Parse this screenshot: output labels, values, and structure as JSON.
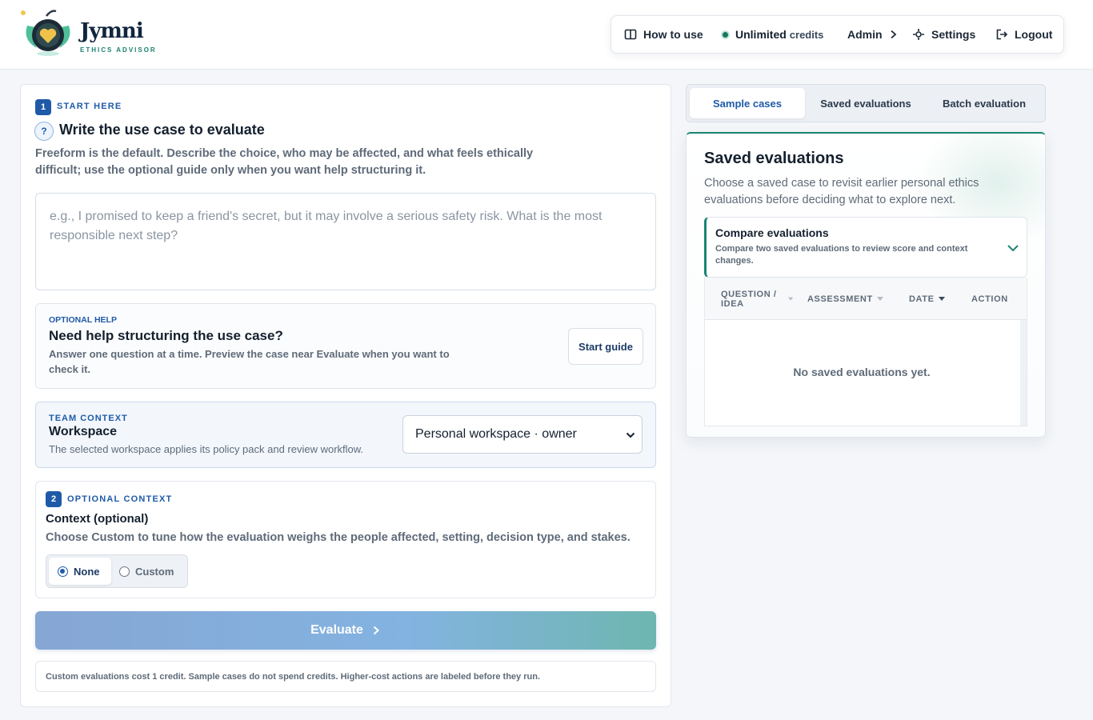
{
  "brand": {
    "name": "Jymni",
    "tagline": "ETHICS ADVISOR"
  },
  "topnav": {
    "how_to_use": "How to use",
    "credits_value": "Unlimited",
    "credits_suffix": "credits",
    "admin": "Admin",
    "settings": "Settings",
    "logout": "Logout"
  },
  "step1": {
    "number": "1",
    "eyebrow": "START HERE",
    "help_glyph": "?",
    "title": "Write the use case to evaluate",
    "intro": "Freeform is the default. Describe the choice, who may be affected, and what feels ethically difficult; use the optional guide only when you want help structuring it.",
    "textarea_value": "",
    "textarea_placeholder": "e.g., I promised to keep a friend's secret, but it may involve a serious safety risk. What is the most responsible next step?"
  },
  "guide": {
    "eyebrow": "OPTIONAL HELP",
    "title": "Need help structuring the use case?",
    "description": "Answer one question at a time. Preview the case near Evaluate when you want to check it.",
    "button": "Start guide"
  },
  "team": {
    "eyebrow": "TEAM CONTEXT",
    "title": "Workspace",
    "description": "The selected workspace applies its policy pack and review workflow.",
    "selected_workspace": "Personal workspace · owner"
  },
  "step2": {
    "number": "2",
    "eyebrow": "OPTIONAL CONTEXT",
    "title": "Context (optional)",
    "description": "Choose Custom to tune how the evaluation weighs the people affected, setting, decision type, and stakes.",
    "options": [
      "None",
      "Custom"
    ],
    "selected": "None"
  },
  "evaluate": {
    "label": "Evaluate",
    "note": "Custom evaluations cost 1 credit. Sample cases do not spend credits. Higher-cost actions are labeled before they run."
  },
  "tabs": {
    "items": [
      "Sample cases",
      "Saved evaluations",
      "Batch evaluation"
    ],
    "active": "Sample cases"
  },
  "saved": {
    "title": "Saved evaluations",
    "description": "Choose a saved case to revisit earlier personal ethics evaluations before deciding what to explore next.",
    "compare_title": "Compare evaluations",
    "compare_description": "Compare two saved evaluations to review score and context changes.",
    "columns": [
      "QUESTION / IDEA",
      "ASSESSMENT",
      "DATE",
      "ACTION"
    ],
    "empty_message": "No saved evaluations yet."
  },
  "colors": {
    "accent_blue": "#1f5aa8",
    "accent_teal": "#1a8472",
    "credit_dot": "#147a62"
  }
}
